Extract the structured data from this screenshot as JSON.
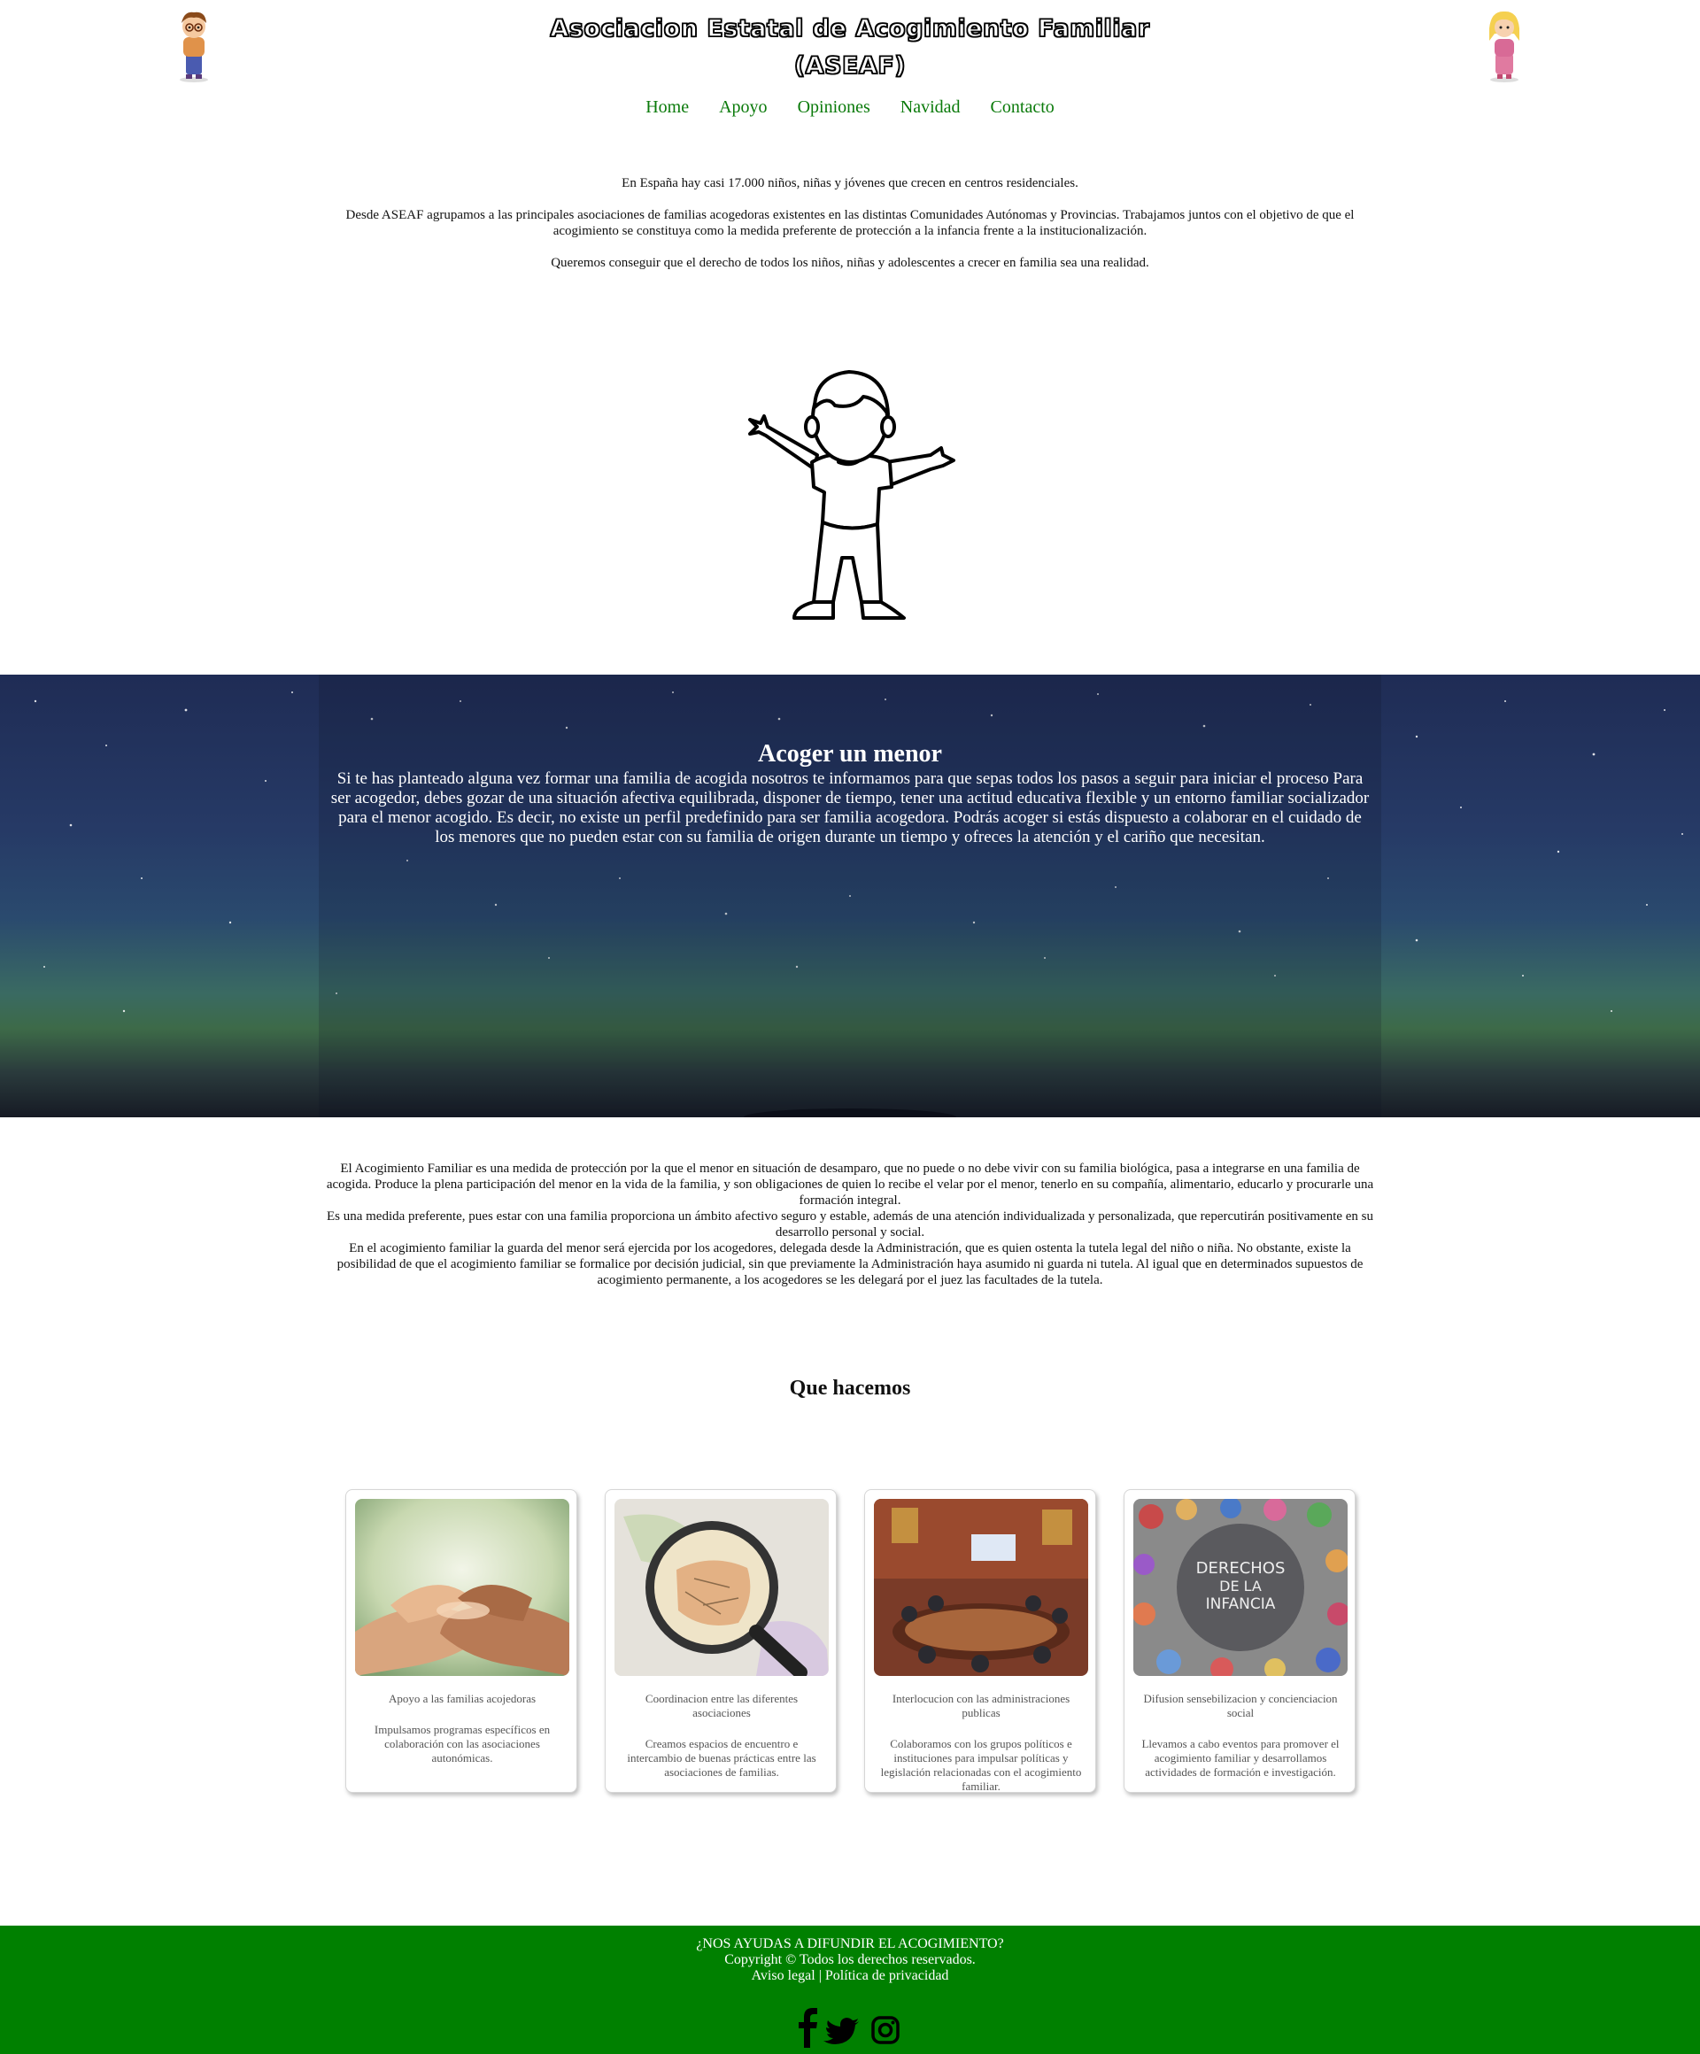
{
  "header": {
    "title": "Asociacion Estatal de Acogimiento Familiar (ASEAF)",
    "nav": [
      "Home",
      "Apoyo",
      "Opiniones",
      "Navidad",
      "Contacto"
    ]
  },
  "intro": {
    "p1": "En España hay casi 17.000 niños, niñas y jóvenes que crecen en centros residenciales.",
    "p2": "Desde ASEAF agrupamos a las principales asociaciones de familias acogedoras existentes en las distintas Comunidades Autónomas y Provincias. Trabajamos juntos con el objetivo de que el acogimiento se constituya como la medida preferente de protección a la infancia frente a la institucionalización.",
    "p3": "Queremos conseguir que el derecho de todos los niños, niñas y adolescentes a crecer en familia sea una realidad."
  },
  "acoger": {
    "title": "Acoger un menor",
    "text": "Si te has planteado alguna vez formar una familia de acogida nosotros te informamos para que sepas todos los pasos a seguir para iniciar el proceso Para ser acogedor, debes gozar de una situación afectiva equilibrada, disponer de tiempo, tener una actitud educativa flexible y un entorno familiar socializador para el menor acogido. Es decir, no existe un perfil predefinido para ser familia acogedora. Podrás acoger si estás dispuesto a colaborar en el cuidado de los menores que no pueden estar con su familia de origen durante un tiempo y ofreces la atención y el cariño que necesitan."
  },
  "description": {
    "p1": "El Acogimiento Familiar es una medida de protección por la que el menor en situación de desamparo, que no puede o no debe vivir con su familia biológica, pasa a integrarse en una familia de acogida. Produce la plena participación del menor en la vida de la familia, y son obligaciones de quien lo recibe el velar por el menor, tenerlo en su compañía, alimentario, educarlo y procurarle una formación integral.",
    "p2": "Es una medida preferente, pues estar con una familia proporciona un ámbito afectivo seguro y estable, además de una atención individualizada y personalizada, que repercutirán positivamente en su desarrollo personal y social.",
    "p3": "En el acogimiento familiar la guarda del menor será ejercida por los acogedores, delegada desde la Administración, que es quien ostenta la tutela legal del niño o niña. No obstante, existe la posibilidad de que el acogimiento familiar se formalice por decisión judicial, sin que previamente la Administración haya asumido ni guarda ni tutela. Al igual que en determinados supuestos de acogimiento permanente, a los acogedores se les delegará por el juez las facultades de la tutela."
  },
  "que_hacemos": {
    "title": "Que hacemos",
    "cards": [
      {
        "title": "Apoyo a las familias acojedoras",
        "text": "Impulsamos programas específicos en colaboración con las asociaciones autonómicas."
      },
      {
        "title": "Coordinacion entre las diferentes asociaciones",
        "text": "Creamos espacios de encuentro e intercambio de buenas prácticas entre las asociaciones de familias."
      },
      {
        "title": "Interlocucion con las administraciones publicas",
        "text": "Colaboramos con los grupos políticos e instituciones para impulsar políticas y legislación relacionadas con el acogimiento familiar."
      },
      {
        "title": "Difusion sensebilizacion y concienciacion social",
        "text": "Llevamos a cabo eventos para promover el acogimiento familiar y desarrollamos actividades de formación e investigación.",
        "image_text": [
          "DERECHOS",
          "DE LA",
          "INFANCIA"
        ]
      }
    ]
  },
  "footer": {
    "line1": "¿NOS AYUDAS A DIFUNDIR EL ACOGIMIENTO?",
    "line2": "Copyright © Todos los derechos reservados.",
    "legal": "Aviso legal",
    "separator": " | ",
    "privacy": "Política de privacidad",
    "social": [
      "facebook-icon",
      "twitter-icon",
      "instagram-icon"
    ]
  },
  "colors": {
    "nav_link": "#0a7a0a",
    "footer_bg": "#008000",
    "sky_top": "#1f2c55"
  }
}
